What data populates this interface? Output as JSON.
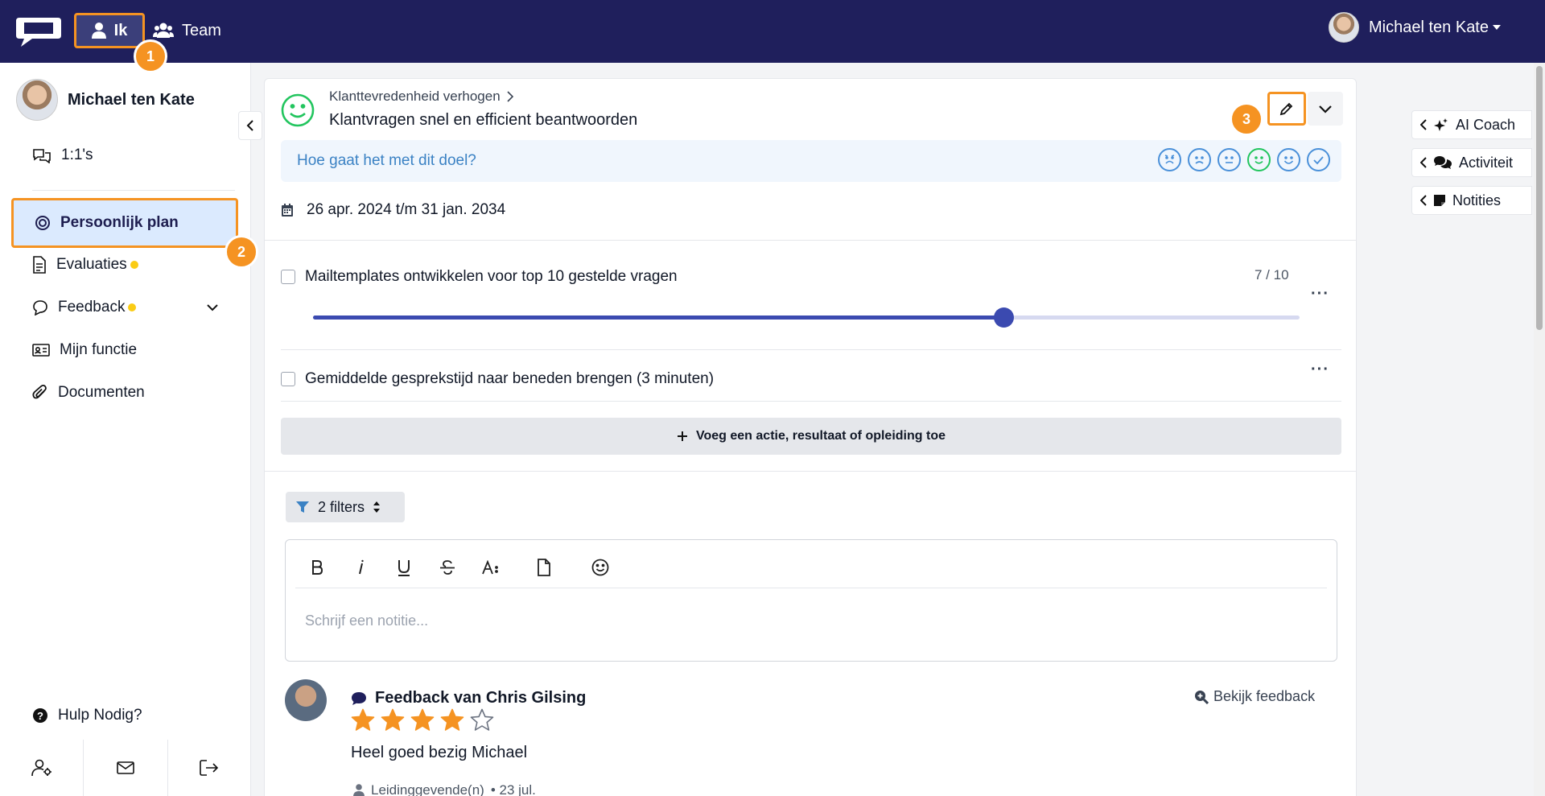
{
  "topbar": {
    "nav_ik": "Ik",
    "nav_team": "Team",
    "user_name": "Michael ten Kate",
    "brand_color": "#1f1f5c",
    "highlight_color": "#f59322"
  },
  "annotations": [
    "1",
    "2",
    "3"
  ],
  "sidebar": {
    "profile_name": "Michael ten Kate",
    "items": [
      {
        "label": "1:1's",
        "icon": "chat-bubbles-icon"
      },
      {
        "label": "Persoonlijk plan",
        "icon": "target-icon",
        "active": true
      },
      {
        "label": "Evaluaties",
        "icon": "document-icon",
        "dot": true
      },
      {
        "label": "Feedback",
        "icon": "speech-bubble-icon",
        "dot": true,
        "expandable": true
      },
      {
        "label": "Mijn functie",
        "icon": "id-card-icon"
      },
      {
        "label": "Documenten",
        "icon": "paperclip-icon"
      }
    ],
    "help": "Hulp Nodig?",
    "bottom_icons": [
      "user-settings-icon",
      "mail-icon",
      "logout-icon"
    ]
  },
  "goal": {
    "parent": "Klanttevredenheid verhogen",
    "title": "Klantvragen snel en efficient beantwoorden",
    "mood_question": "Hoe gaat het met dit doel?",
    "date_range": "26 apr. 2024 t/m 31 jan. 2034"
  },
  "tasks": [
    {
      "label": "Mailtemplates ontwikkelen voor top 10 gestelde vragen",
      "progress_text": "7 / 10",
      "progress": 0.7
    },
    {
      "label": "Gemiddelde gesprekstijd naar beneden brengen (3 minuten)"
    }
  ],
  "add_action": "Voeg een actie, resultaat of opleiding toe",
  "filters": "2 filters",
  "editor": {
    "placeholder": "Schrijf een notitie...",
    "tools": [
      "bold-icon",
      "italic-icon",
      "underline-icon",
      "strikethrough-icon",
      "font-size-icon",
      "file-icon",
      "emoji-icon"
    ]
  },
  "feedback": {
    "title": "Feedback van Chris Gilsing",
    "view": "Bekijk feedback",
    "rating": 4,
    "max_rating": 5,
    "text": "Heel goed bezig Michael",
    "role": "Leidinggevende(n)",
    "date": "• 23 jul."
  },
  "right_tabs": [
    "AI Coach",
    "Activiteit",
    "Notities"
  ]
}
